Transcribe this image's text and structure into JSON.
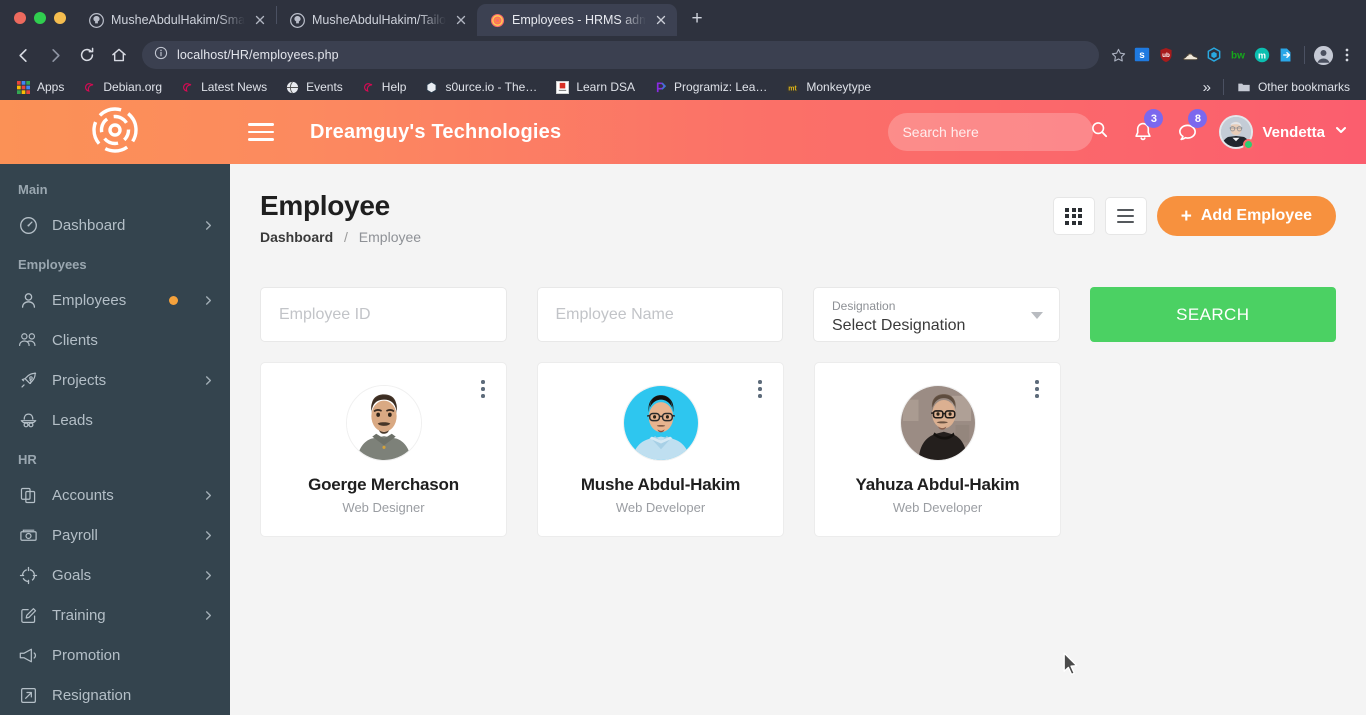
{
  "browser": {
    "tabs": [
      {
        "title": "MusheAbdulHakim/Smart",
        "favicon": "github-icon",
        "active": false
      },
      {
        "title": "MusheAbdulHakim/Tailor",
        "favicon": "github-icon",
        "active": false
      },
      {
        "title": "Employees - HRMS admin",
        "favicon": "hrms-icon",
        "active": true
      }
    ],
    "new_tab_label": "+",
    "url": "localhost/HR/employees.php",
    "nav": {
      "back": "back-arrow",
      "forward": "forward-arrow",
      "reload": "reload-icon",
      "home": "home-icon"
    },
    "star": "bookmark-star-icon",
    "extensions": [
      "s-extension",
      "ublock-extension",
      "sneaker-extension",
      "hex-extension",
      "bw-extension",
      "m-extension",
      "export-extension"
    ],
    "profile": "profile-avatar-icon",
    "menu": "chrome-menu-icon",
    "bookmarks": [
      {
        "label": "Apps",
        "icon": "apps-grid-icon"
      },
      {
        "label": "Debian.org",
        "icon": "debian-icon"
      },
      {
        "label": "Latest News",
        "icon": "debian-icon"
      },
      {
        "label": "Events",
        "icon": "globe-icon"
      },
      {
        "label": "Help",
        "icon": "debian-icon"
      },
      {
        "label": "s0urce.io - The…",
        "icon": "hex-icon"
      },
      {
        "label": "Learn DSA",
        "icon": "dsa-icon"
      },
      {
        "label": "Programiz: Lea…",
        "icon": "programiz-icon"
      },
      {
        "label": "Monkeytype",
        "icon": "monkeytype-icon"
      }
    ],
    "overflow_label": "»",
    "other_bookmarks": {
      "label": "Other bookmarks",
      "icon": "folder-icon"
    }
  },
  "header": {
    "logo": "target-logo-icon",
    "menu_toggle": "hamburger-icon",
    "brand": "Dreamguy's Technologies",
    "search": {
      "placeholder": "Search here",
      "value": "",
      "icon": "search-icon"
    },
    "notifications": {
      "icon": "bell-icon",
      "count": "3"
    },
    "messages": {
      "icon": "chat-bubble-icon",
      "count": "8"
    },
    "user": {
      "name": "Vendetta",
      "status": "online",
      "chevron": "chevron-down-icon"
    }
  },
  "sidebar": {
    "sections": [
      {
        "title": "Main",
        "items": [
          {
            "label": "Dashboard",
            "icon": "speedometer-icon",
            "chevron": true,
            "dot": false
          }
        ]
      },
      {
        "title": "Employees",
        "items": [
          {
            "label": "Employees",
            "icon": "user-icon",
            "chevron": true,
            "dot": true
          },
          {
            "label": "Clients",
            "icon": "users-icon",
            "chevron": false,
            "dot": false
          },
          {
            "label": "Projects",
            "icon": "rocket-icon",
            "chevron": true,
            "dot": false
          },
          {
            "label": "Leads",
            "icon": "spy-icon",
            "chevron": false,
            "dot": false
          }
        ]
      },
      {
        "title": "HR",
        "items": [
          {
            "label": "Accounts",
            "icon": "copy-icon",
            "chevron": true,
            "dot": false
          },
          {
            "label": "Payroll",
            "icon": "money-icon",
            "chevron": true,
            "dot": false
          },
          {
            "label": "Goals",
            "icon": "crosshair-icon",
            "chevron": true,
            "dot": false
          },
          {
            "label": "Training",
            "icon": "edit-square-icon",
            "chevron": true,
            "dot": false
          },
          {
            "label": "Promotion",
            "icon": "megaphone-icon",
            "chevron": false,
            "dot": false
          },
          {
            "label": "Resignation",
            "icon": "arrow-out-icon",
            "chevron": false,
            "dot": false
          }
        ]
      }
    ]
  },
  "main": {
    "page_title": "Employee",
    "breadcrumb": {
      "parent": "Dashboard",
      "separator": "/",
      "current": "Employee"
    },
    "actions": {
      "grid_view": "grid-view-icon",
      "list_view": "list-view-icon",
      "add_label": "Add Employee",
      "add_plus": "+"
    },
    "filters": {
      "employee_id": {
        "placeholder": "Employee ID",
        "value": ""
      },
      "employee_name": {
        "placeholder": "Employee Name",
        "value": ""
      },
      "designation": {
        "label": "Designation",
        "value": "Select Designation"
      },
      "search_label": "SEARCH"
    },
    "employees": [
      {
        "name": "Goerge Merchason",
        "role": "Web Designer",
        "menu": "kebab-menu-icon",
        "photo": "photo-male-beard-grey-hoodie"
      },
      {
        "name": "Mushe Abdul-Hakim",
        "role": "Web Developer",
        "menu": "kebab-menu-icon",
        "photo": "photo-male-glasses-cyan-bg"
      },
      {
        "name": "Yahuza Abdul-Hakim",
        "role": "Web Developer",
        "menu": "kebab-menu-icon",
        "photo": "photo-male-glasses-turtleneck"
      }
    ]
  },
  "colors": {
    "header_start": "#fb9156",
    "header_end": "#fb5e6e",
    "sidebar": "#34444e",
    "accent_orange": "#f7913e",
    "search_green": "#4bd163",
    "badge_purple": "#7b68ee",
    "online_green": "#2ecc71",
    "page_bg": "#f4f4f4"
  }
}
